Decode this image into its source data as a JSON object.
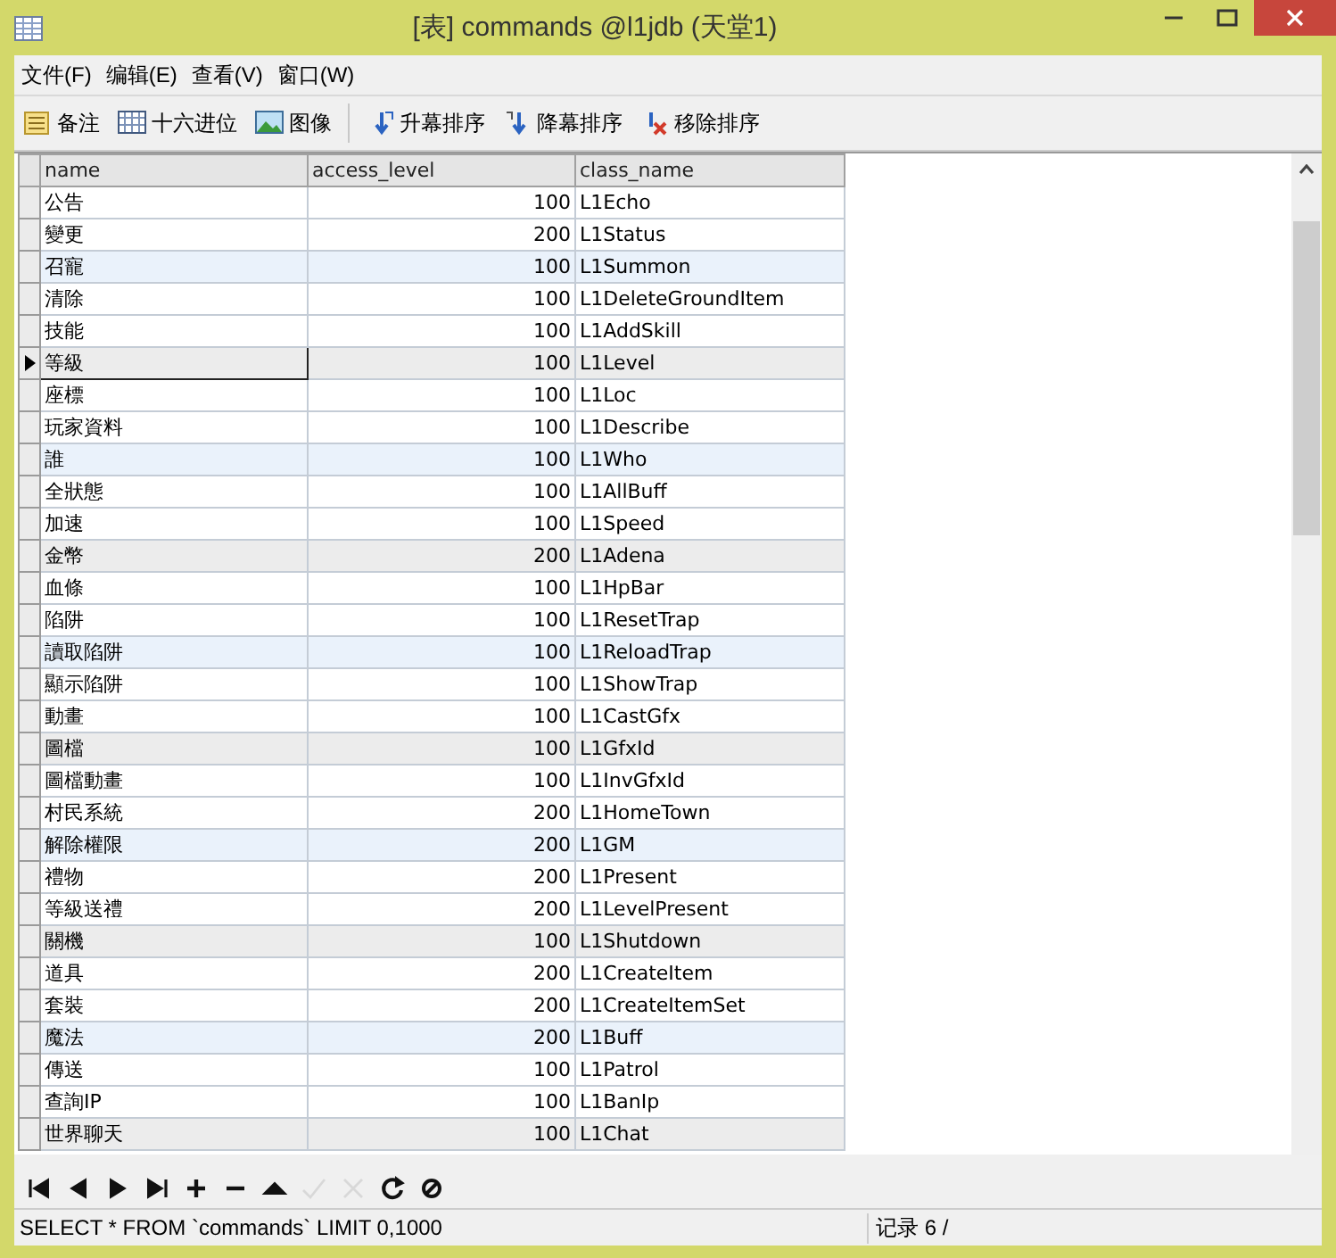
{
  "window": {
    "title": "[表] commands @l1jdb (天堂1)"
  },
  "menu": [
    "文件(F)",
    "编辑(E)",
    "查看(V)",
    "窗口(W)"
  ],
  "toolbar": [
    {
      "kind": "memo",
      "label": "备注"
    },
    {
      "kind": "hex",
      "label": "十六进位"
    },
    {
      "kind": "image",
      "label": "图像"
    },
    {
      "kind": "asc",
      "label": "升幕排序"
    },
    {
      "kind": "desc",
      "label": "降幕排序"
    },
    {
      "kind": "remove",
      "label": "移除排序"
    }
  ],
  "table": {
    "columns": [
      "name",
      "access_level",
      "class_name"
    ],
    "rows": [
      {
        "cells": [
          "公告",
          "100",
          "L1Echo"
        ],
        "selected": false
      },
      {
        "cells": [
          "變更",
          "200",
          "L1Status"
        ],
        "selected": false
      },
      {
        "cells": [
          "召寵",
          "100",
          "L1Summon"
        ],
        "selected": false,
        "color": "#eaf2fb"
      },
      {
        "cells": [
          "清除",
          "100",
          "L1DeleteGroundItem"
        ],
        "selected": false
      },
      {
        "cells": [
          "技能",
          "100",
          "L1AddSkill"
        ],
        "selected": false
      },
      {
        "cells": [
          "等級",
          "100",
          "L1Level"
        ],
        "selected": true,
        "color": "#ececec"
      },
      {
        "cells": [
          "座標",
          "100",
          "L1Loc"
        ],
        "selected": false
      },
      {
        "cells": [
          "玩家資料",
          "100",
          "L1Describe"
        ],
        "selected": false
      },
      {
        "cells": [
          "誰",
          "100",
          "L1Who"
        ],
        "selected": false,
        "color": "#eaf2fb"
      },
      {
        "cells": [
          "全狀態",
          "100",
          "L1AllBuff"
        ],
        "selected": false
      },
      {
        "cells": [
          "加速",
          "100",
          "L1Speed"
        ],
        "selected": false
      },
      {
        "cells": [
          "金幣",
          "200",
          "L1Adena"
        ],
        "selected": false,
        "color": "#ececec"
      },
      {
        "cells": [
          "血條",
          "100",
          "L1HpBar"
        ],
        "selected": false
      },
      {
        "cells": [
          "陷阱",
          "100",
          "L1ResetTrap"
        ],
        "selected": false
      },
      {
        "cells": [
          "讀取陷阱",
          "100",
          "L1ReloadTrap"
        ],
        "selected": false,
        "color": "#eaf2fb"
      },
      {
        "cells": [
          "顯示陷阱",
          "100",
          "L1ShowTrap"
        ],
        "selected": false
      },
      {
        "cells": [
          "動畫",
          "100",
          "L1CastGfx"
        ],
        "selected": false
      },
      {
        "cells": [
          "圖檔",
          "100",
          "L1GfxId"
        ],
        "selected": false,
        "color": "#ececec"
      },
      {
        "cells": [
          "圖檔動畫",
          "100",
          "L1InvGfxId"
        ],
        "selected": false
      },
      {
        "cells": [
          "村民系統",
          "200",
          "L1HomeTown"
        ],
        "selected": false
      },
      {
        "cells": [
          "解除權限",
          "200",
          "L1GM"
        ],
        "selected": false,
        "color": "#eaf2fb"
      },
      {
        "cells": [
          "禮物",
          "200",
          "L1Present"
        ],
        "selected": false
      },
      {
        "cells": [
          "等級送禮",
          "200",
          "L1LevelPresent"
        ],
        "selected": false
      },
      {
        "cells": [
          "關機",
          "100",
          "L1Shutdown"
        ],
        "selected": false,
        "color": "#ececec"
      },
      {
        "cells": [
          "道具",
          "200",
          "L1CreateItem"
        ],
        "selected": false
      },
      {
        "cells": [
          "套裝",
          "200",
          "L1CreateItemSet"
        ],
        "selected": false
      },
      {
        "cells": [
          "魔法",
          "200",
          "L1Buff"
        ],
        "selected": false,
        "color": "#eaf2fb"
      },
      {
        "cells": [
          "傳送",
          "100",
          "L1Patrol"
        ],
        "selected": false
      },
      {
        "cells": [
          "查詢IP",
          "100",
          "L1BanIp"
        ],
        "selected": false
      },
      {
        "cells": [
          "世界聊天",
          "100",
          "L1Chat"
        ],
        "selected": false,
        "color": "#ececec"
      }
    ]
  },
  "navigator": [
    {
      "kind": "first",
      "disabled": false
    },
    {
      "kind": "prev",
      "disabled": false
    },
    {
      "kind": "next",
      "disabled": false
    },
    {
      "kind": "last",
      "disabled": false
    },
    {
      "kind": "add",
      "disabled": false
    },
    {
      "kind": "delete",
      "disabled": false
    },
    {
      "kind": "up",
      "disabled": false
    },
    {
      "kind": "apply",
      "disabled": true
    },
    {
      "kind": "cancel",
      "disabled": true
    },
    {
      "kind": "refresh",
      "disabled": false
    },
    {
      "kind": "stop",
      "disabled": false
    }
  ],
  "status_bar": {
    "query": "SELECT * FROM `commands` LIMIT 0,1000",
    "record": "记录 6 /"
  }
}
